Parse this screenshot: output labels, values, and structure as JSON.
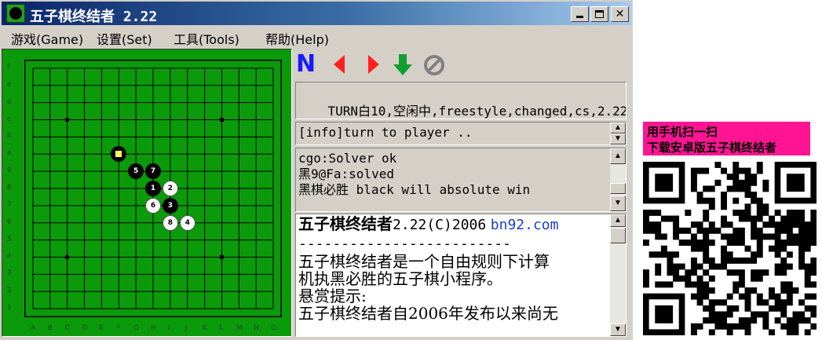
{
  "window": {
    "title": "五子棋终结者 2.22",
    "controls": [
      "minimize",
      "maximize",
      "close"
    ]
  },
  "menu": [
    {
      "label": "游戏(Game)",
      "hotkey": "G"
    },
    {
      "label": "设置(Set)",
      "hotkey": "S"
    },
    {
      "label": "工具(Tools)",
      "hotkey": "T"
    },
    {
      "label": "帮助(Help)",
      "hotkey": "H"
    }
  ],
  "board": {
    "background": "#0a9a0a",
    "columns": [
      "A",
      "B",
      "C",
      "D",
      "E",
      "F",
      "G",
      "H",
      "I",
      "J",
      "K",
      "L",
      "M",
      "N",
      "O"
    ],
    "rows": [
      "f",
      "e",
      "d",
      "c",
      "b",
      "a",
      "9",
      "8",
      "7",
      "6",
      "5",
      "4",
      "3",
      "2",
      "1"
    ],
    "star_points": [
      [
        "C",
        "c"
      ],
      [
        "L",
        "c"
      ],
      [
        "C",
        "4"
      ],
      [
        "L",
        "4"
      ]
    ],
    "stones": [
      {
        "col": "F",
        "row": "a",
        "color": "black",
        "label": "",
        "last_move": true
      },
      {
        "col": "G",
        "row": "9",
        "color": "black",
        "label": "5"
      },
      {
        "col": "H",
        "row": "9",
        "color": "black",
        "label": "7"
      },
      {
        "col": "H",
        "row": "8",
        "color": "black",
        "label": "1"
      },
      {
        "col": "I",
        "row": "8",
        "color": "white",
        "label": "2"
      },
      {
        "col": "H",
        "row": "7",
        "color": "white",
        "label": "6"
      },
      {
        "col": "I",
        "row": "7",
        "color": "black",
        "label": "3"
      },
      {
        "col": "I",
        "row": "6",
        "color": "white",
        "label": "8"
      },
      {
        "col": "J",
        "row": "6",
        "color": "white",
        "label": "4"
      }
    ]
  },
  "toolbar": [
    {
      "name": "new-game",
      "glyph": "N",
      "color": "#1a1aff"
    },
    {
      "name": "undo",
      "glyph": "◀",
      "color": "#ff2020"
    },
    {
      "name": "redo",
      "glyph": "▶",
      "color": "#ff2020"
    },
    {
      "name": "solve",
      "glyph": "↓",
      "color": "#10a030"
    },
    {
      "name": "stop",
      "glyph": "⊘",
      "color": "#808080"
    }
  ],
  "status": {
    "text": "TURN白10,空闲中,freestyle,changed,cs,2.22"
  },
  "info": {
    "text": "[info]turn to player .."
  },
  "log": {
    "lines": [
      "cgo:Solver ok",
      "黑9@Fa:solved",
      "黑棋必胜 black will absolute win"
    ]
  },
  "about": {
    "title": "五子棋终结者",
    "version": "2.22(C)2006",
    "link": "bn92.com",
    "separator": "-------------------------",
    "body": [
      "五子棋终结者是一个自由规则下计算",
      "机执黑必胜的五子棋小程序。",
      "悬赏提示:",
      "五子棋终结者自2006年发布以来尚无"
    ]
  },
  "qr": {
    "banner_lines": [
      "用手机扫一扫",
      "下载安卓版五子棋终结者"
    ],
    "banner_color": "#ff1493"
  }
}
